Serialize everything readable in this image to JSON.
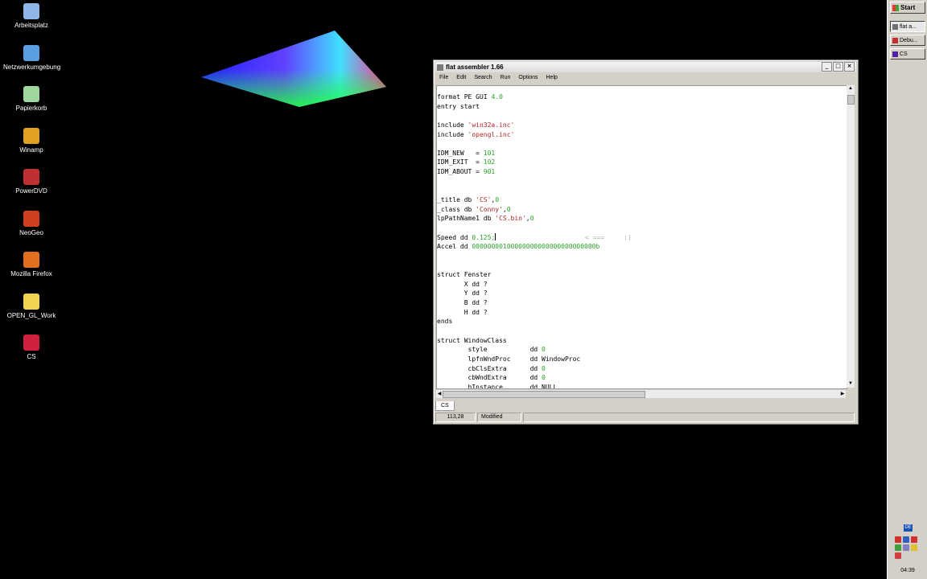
{
  "desktop": {
    "icons": [
      {
        "label": "Arbeitsplatz",
        "icon": "computer-icon",
        "color": "#8fb6e6"
      },
      {
        "label": "Netzwerkumgebung",
        "icon": "network-icon",
        "color": "#5aa0e0"
      },
      {
        "label": "Papierkorb",
        "icon": "recycle-bin-icon",
        "color": "#9ed79e"
      },
      {
        "label": "Winamp",
        "icon": "winamp-icon",
        "color": "#e0a020"
      },
      {
        "label": "PowerDVD",
        "icon": "powerdvd-icon",
        "color": "#c03030"
      },
      {
        "label": "NeoGeo",
        "icon": "neogeo-icon",
        "color": "#d04020"
      },
      {
        "label": "Mozilla Firefox",
        "icon": "firefox-icon",
        "color": "#e07020"
      },
      {
        "label": "OPEN_GL_Work",
        "icon": "folder-icon",
        "color": "#f2d34f"
      },
      {
        "label": "CS",
        "icon": "cs-app-icon",
        "color": "#d02040"
      }
    ]
  },
  "window": {
    "title": "flat assembler 1.66",
    "menu": [
      "File",
      "Edit",
      "Search",
      "Run",
      "Options",
      "Help"
    ],
    "tab": "CS",
    "status": {
      "position": "113,28",
      "state": "Modified",
      "extra": ""
    }
  },
  "code": [
    [
      {
        "t": "format PE GUI "
      },
      {
        "t": "4.0",
        "c": "num"
      }
    ],
    [
      {
        "t": "entry start"
      }
    ],
    [
      {
        "t": ""
      }
    ],
    [
      {
        "t": "include "
      },
      {
        "t": "'win32a.inc'",
        "c": "str"
      }
    ],
    [
      {
        "t": "include "
      },
      {
        "t": "'opengl.inc'",
        "c": "str"
      }
    ],
    [
      {
        "t": ""
      }
    ],
    [
      {
        "t": "IDM_NEW   = "
      },
      {
        "t": "101",
        "c": "num"
      }
    ],
    [
      {
        "t": "IDM_EXIT  = "
      },
      {
        "t": "102",
        "c": "num"
      }
    ],
    [
      {
        "t": "IDM_ABOUT = "
      },
      {
        "t": "901",
        "c": "num"
      }
    ],
    [
      {
        "t": ""
      }
    ],
    [
      {
        "t": ""
      }
    ],
    [
      {
        "t": "_title db "
      },
      {
        "t": "'CS'",
        "c": "str"
      },
      {
        "t": ","
      },
      {
        "t": "0",
        "c": "num"
      }
    ],
    [
      {
        "t": "_class db "
      },
      {
        "t": "'Conny'",
        "c": "str"
      },
      {
        "t": ","
      },
      {
        "t": "0",
        "c": "num"
      }
    ],
    [
      {
        "t": "lpPathName1 db "
      },
      {
        "t": "'CS.bin'",
        "c": "str"
      },
      {
        "t": ","
      },
      {
        "t": "0",
        "c": "num"
      }
    ],
    [
      {
        "t": ""
      }
    ],
    [
      {
        "t": "Speed dd "
      },
      {
        "t": "0.125",
        "c": "num"
      },
      {
        "t": ";",
        "c": "num"
      },
      {
        "t": "|",
        "c": "cursor"
      },
      {
        "t": "                       < ===     :)",
        "c": "cmt"
      }
    ],
    [
      {
        "t": "Accel dd "
      },
      {
        "t": "00000000100000000000000000000000b",
        "c": "num"
      }
    ],
    [
      {
        "t": ""
      }
    ],
    [
      {
        "t": ""
      }
    ],
    [
      {
        "t": "struct Fenster"
      }
    ],
    [
      {
        "t": "       X dd ?"
      }
    ],
    [
      {
        "t": "       Y dd ?"
      }
    ],
    [
      {
        "t": "       B dd ?"
      }
    ],
    [
      {
        "t": "       H dd ?"
      }
    ],
    [
      {
        "t": "ends"
      }
    ],
    [
      {
        "t": ""
      }
    ],
    [
      {
        "t": "struct WindowClass"
      }
    ],
    [
      {
        "t": "        style           dd "
      },
      {
        "t": "0",
        "c": "num"
      }
    ],
    [
      {
        "t": "        lpfnWndProc     dd WindowProc"
      }
    ],
    [
      {
        "t": "        cbClsExtra      dd "
      },
      {
        "t": "0",
        "c": "num"
      }
    ],
    [
      {
        "t": "        cbWndExtra      dd "
      },
      {
        "t": "0",
        "c": "num"
      }
    ],
    [
      {
        "t": "        hInstance       dd NULL"
      }
    ]
  ],
  "taskbar": {
    "start_label": "Start",
    "tasks": [
      {
        "label": "flat a...",
        "icon": "fasm-icon",
        "color": "#707070",
        "active": true
      },
      {
        "label": "Debu...",
        "icon": "debug-icon",
        "color": "#c03030",
        "active": false
      },
      {
        "label": "CS",
        "icon": "cs-app-icon",
        "color": "#5020a0",
        "active": false
      }
    ],
    "lang": "DE",
    "tray_icons": [
      {
        "icon": "tray-icon-1",
        "color": "#d03030"
      },
      {
        "icon": "tray-icon-2",
        "color": "#3060c0"
      },
      {
        "icon": "tray-icon-3",
        "color": "#d03030"
      },
      {
        "icon": "tray-icon-4",
        "color": "#40a040"
      },
      {
        "icon": "tray-icon-5",
        "color": "#8080c0"
      },
      {
        "icon": "tray-icon-6",
        "color": "#e0c030"
      },
      {
        "icon": "tray-icon-7",
        "color": "#d04040"
      }
    ],
    "clock": "04:39"
  }
}
